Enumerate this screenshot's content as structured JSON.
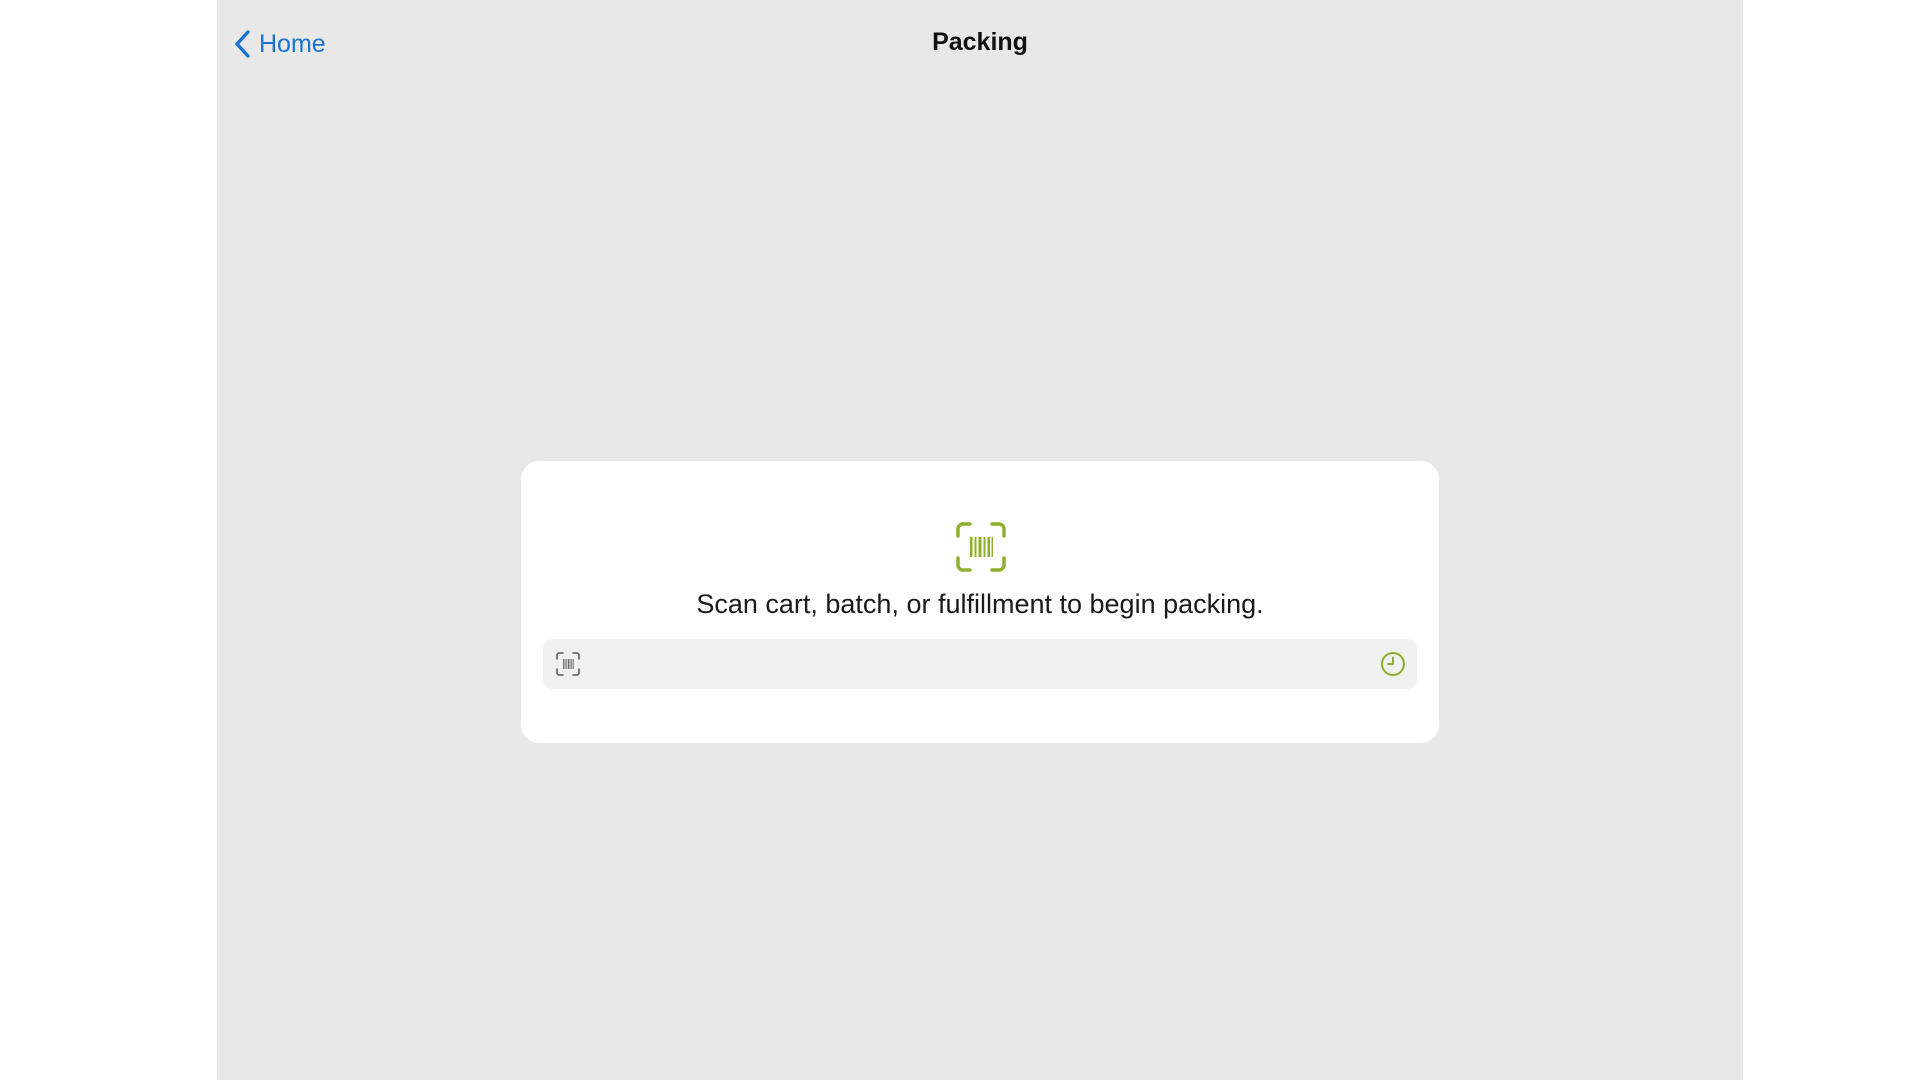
{
  "nav": {
    "back_label": "Home",
    "title": "Packing"
  },
  "card": {
    "icon": "barcode-scan-icon",
    "message": "Scan cart, batch, or fulfillment to begin packing.",
    "scan_field": {
      "value": "",
      "placeholder": "",
      "left_icon": "barcode-scan-icon",
      "right_icon": "clock-history-icon"
    }
  },
  "colors": {
    "background": "#e8e8e8",
    "card": "#ffffff",
    "accent_link": "#1a73d1",
    "accent_green": "#8db02a",
    "field_bg": "#f1f1f1"
  }
}
